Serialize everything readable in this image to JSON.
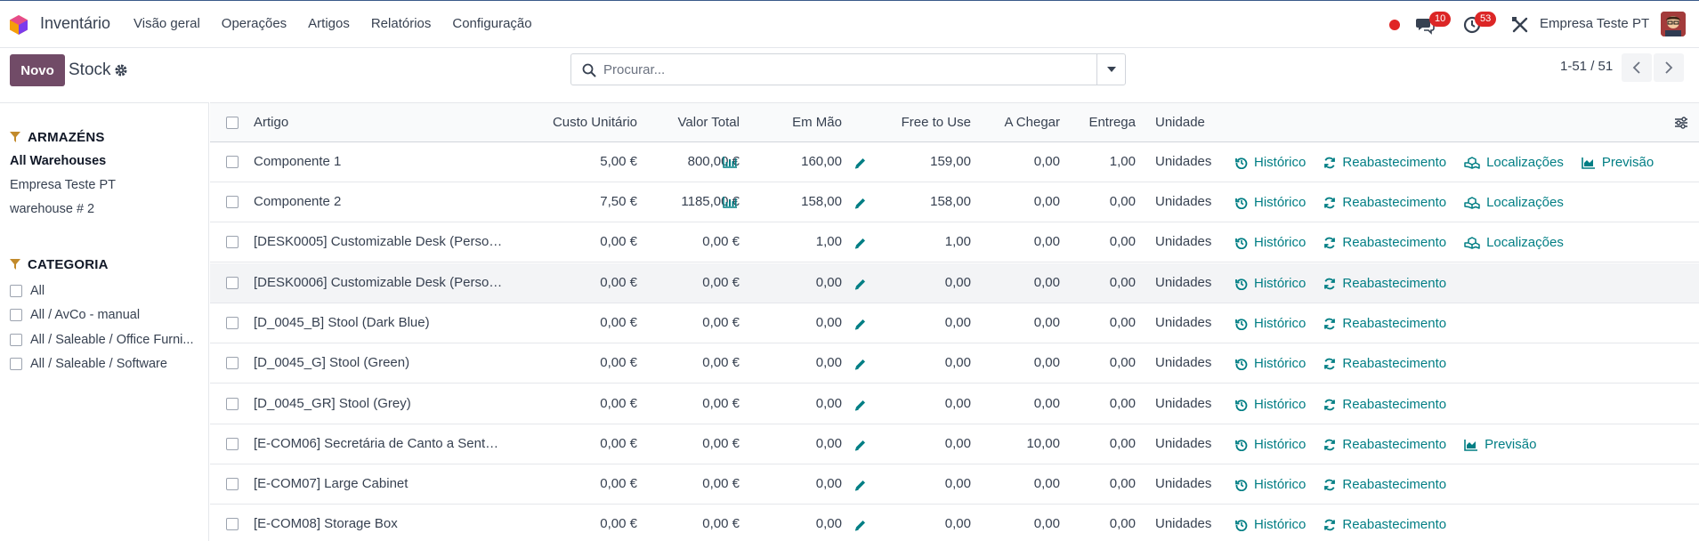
{
  "navbar": {
    "app_name": "Inventário",
    "menu": [
      "Visão geral",
      "Operações",
      "Artigos",
      "Relatórios",
      "Configuração"
    ],
    "chat_badge": "10",
    "activity_badge": "53",
    "company": "Empresa Teste PT"
  },
  "control": {
    "new_button": "Novo",
    "breadcrumb": "Stock",
    "search_placeholder": "Procurar...",
    "pager": "1-51 / 51"
  },
  "sidepanel": {
    "warehouses_title": "ARMAZÉNS",
    "warehouses": [
      "All Warehouses",
      "Empresa Teste PT",
      "warehouse # 2"
    ],
    "category_title": "CATEGORIA",
    "categories": [
      "All",
      "All / AvCo - manual",
      "All / Saleable / Office Furni...",
      "All / Saleable / Software"
    ]
  },
  "table": {
    "headers": {
      "artigo": "Artigo",
      "custo": "Custo Unitário",
      "valor": "Valor Total",
      "emmao": "Em Mão",
      "free": "Free to Use",
      "chegar": "A Chegar",
      "entrega": "Entrega",
      "unidade": "Unidade"
    },
    "action_labels": {
      "historico": "Histórico",
      "reabastecimento": "Reabastecimento",
      "localizacoes": "Localizações",
      "previsao": "Previsão"
    },
    "rows": [
      {
        "name": "Componente 1",
        "custo": "5,00 €",
        "valor": "800,00 €",
        "emmao": "160,00",
        "free": "159,00",
        "chegar": "0,00",
        "entrega": "1,00",
        "unidade": "Unidades"
      },
      {
        "name": "Componente 2",
        "custo": "7,50 €",
        "valor": "1185,00 €",
        "emmao": "158,00",
        "free": "158,00",
        "chegar": "0,00",
        "entrega": "0,00",
        "unidade": "Unidades"
      },
      {
        "name": "[DESK0005] Customizable Desk (Person...",
        "custo": "0,00 €",
        "valor": "0,00 €",
        "emmao": "1,00",
        "free": "1,00",
        "chegar": "0,00",
        "entrega": "0,00",
        "unidade": "Unidades"
      },
      {
        "name": "[DESK0006] Customizable Desk (Person...",
        "custo": "0,00 €",
        "valor": "0,00 €",
        "emmao": "0,00",
        "free": "0,00",
        "chegar": "0,00",
        "entrega": "0,00",
        "unidade": "Unidades"
      },
      {
        "name": "[D_0045_B] Stool (Dark Blue)",
        "custo": "0,00 €",
        "valor": "0,00 €",
        "emmao": "0,00",
        "free": "0,00",
        "chegar": "0,00",
        "entrega": "0,00",
        "unidade": "Unidades"
      },
      {
        "name": "[D_0045_G] Stool (Green)",
        "custo": "0,00 €",
        "valor": "0,00 €",
        "emmao": "0,00",
        "free": "0,00",
        "chegar": "0,00",
        "entrega": "0,00",
        "unidade": "Unidades"
      },
      {
        "name": "[D_0045_GR] Stool (Grey)",
        "custo": "0,00 €",
        "valor": "0,00 €",
        "emmao": "0,00",
        "free": "0,00",
        "chegar": "0,00",
        "entrega": "0,00",
        "unidade": "Unidades"
      },
      {
        "name": "[E-COM06] Secretária de Canto a Senta...",
        "custo": "0,00 €",
        "valor": "0,00 €",
        "emmao": "0,00",
        "free": "0,00",
        "chegar": "10,00",
        "entrega": "0,00",
        "unidade": "Unidades"
      },
      {
        "name": "[E-COM07] Large Cabinet",
        "custo": "0,00 €",
        "valor": "0,00 €",
        "emmao": "0,00",
        "free": "0,00",
        "chegar": "0,00",
        "entrega": "0,00",
        "unidade": "Unidades"
      },
      {
        "name": "[E-COM08] Storage Box",
        "custo": "0,00 €",
        "valor": "0,00 €",
        "emmao": "0,00",
        "free": "0,00",
        "chegar": "0,00",
        "entrega": "0,00",
        "unidade": "Unidades"
      }
    ]
  }
}
